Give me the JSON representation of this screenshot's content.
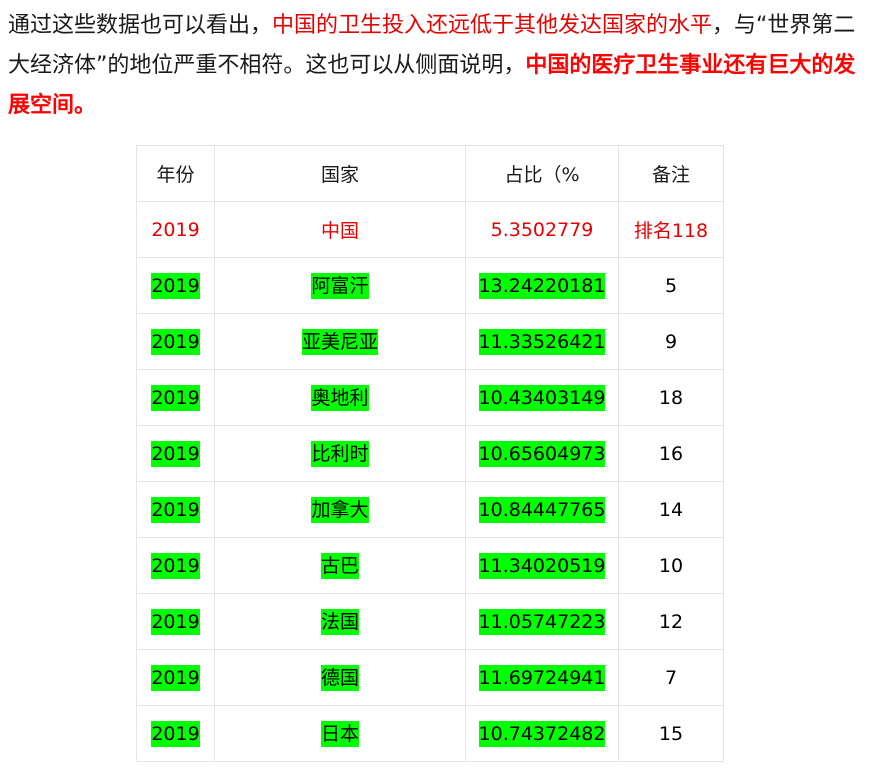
{
  "paragraph": {
    "part1": "通过这些数据也可以看出，",
    "part2_red": "中国的卫生投入还远低于其他发达国家的水平",
    "part3": "，与“世界第二大经济体”的地位严重不相符。这也可以从侧面说明，",
    "part4_bold_red": "中国的医疗卫生事业还有巨大的发展空间。"
  },
  "table": {
    "headers": [
      "年份",
      "国家",
      "占比（%",
      "备注"
    ],
    "china_row": {
      "year": "2019",
      "country": "中国",
      "pct": "5.3502779",
      "note": "排名118"
    },
    "rows": [
      {
        "year": "2019",
        "country": "阿富汗",
        "pct": "13.24220181",
        "note": "5"
      },
      {
        "year": "2019",
        "country": "亚美尼亚",
        "pct": "11.33526421",
        "note": "9"
      },
      {
        "year": "2019",
        "country": "奥地利",
        "pct": "10.43403149",
        "note": "18"
      },
      {
        "year": "2019",
        "country": "比利时",
        "pct": "10.65604973",
        "note": "16"
      },
      {
        "year": "2019",
        "country": "加拿大",
        "pct": "10.84447765",
        "note": "14"
      },
      {
        "year": "2019",
        "country": "古巴",
        "pct": "11.34020519",
        "note": "10"
      },
      {
        "year": "2019",
        "country": "法国",
        "pct": "11.05747223",
        "note": "12"
      },
      {
        "year": "2019",
        "country": "德国",
        "pct": "11.69724941",
        "note": "7"
      },
      {
        "year": "2019",
        "country": "日本",
        "pct": "10.74372482",
        "note": "15"
      }
    ]
  },
  "colors": {
    "red_text": "#e60000",
    "highlight": "#00ff00",
    "border": "#e4e4e4"
  }
}
